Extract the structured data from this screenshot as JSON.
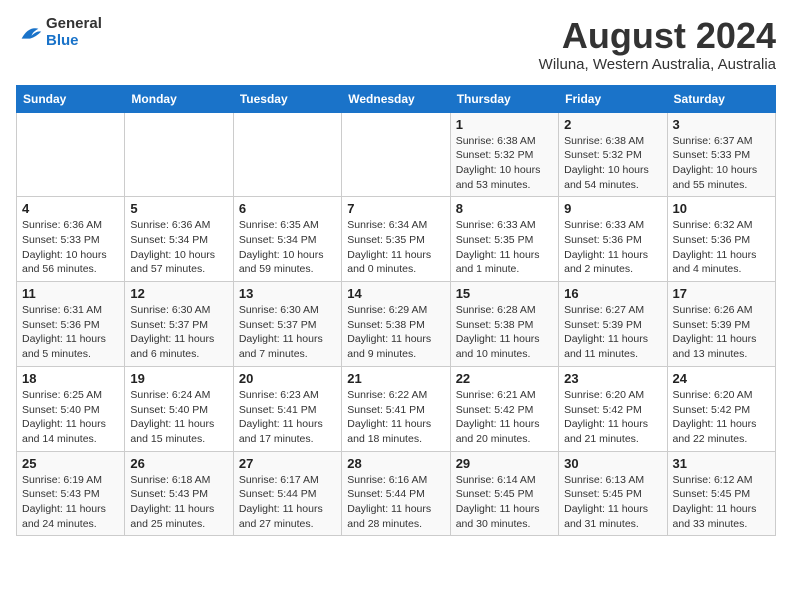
{
  "logo": {
    "text_general": "General",
    "text_blue": "Blue"
  },
  "header": {
    "title": "August 2024",
    "subtitle": "Wiluna, Western Australia, Australia"
  },
  "days_of_week": [
    "Sunday",
    "Monday",
    "Tuesday",
    "Wednesday",
    "Thursday",
    "Friday",
    "Saturday"
  ],
  "weeks": [
    [
      {
        "day": "",
        "info": ""
      },
      {
        "day": "",
        "info": ""
      },
      {
        "day": "",
        "info": ""
      },
      {
        "day": "",
        "info": ""
      },
      {
        "day": "1",
        "info": "Sunrise: 6:38 AM\nSunset: 5:32 PM\nDaylight: 10 hours and 53 minutes."
      },
      {
        "day": "2",
        "info": "Sunrise: 6:38 AM\nSunset: 5:32 PM\nDaylight: 10 hours and 54 minutes."
      },
      {
        "day": "3",
        "info": "Sunrise: 6:37 AM\nSunset: 5:33 PM\nDaylight: 10 hours and 55 minutes."
      }
    ],
    [
      {
        "day": "4",
        "info": "Sunrise: 6:36 AM\nSunset: 5:33 PM\nDaylight: 10 hours and 56 minutes."
      },
      {
        "day": "5",
        "info": "Sunrise: 6:36 AM\nSunset: 5:34 PM\nDaylight: 10 hours and 57 minutes."
      },
      {
        "day": "6",
        "info": "Sunrise: 6:35 AM\nSunset: 5:34 PM\nDaylight: 10 hours and 59 minutes."
      },
      {
        "day": "7",
        "info": "Sunrise: 6:34 AM\nSunset: 5:35 PM\nDaylight: 11 hours and 0 minutes."
      },
      {
        "day": "8",
        "info": "Sunrise: 6:33 AM\nSunset: 5:35 PM\nDaylight: 11 hours and 1 minute."
      },
      {
        "day": "9",
        "info": "Sunrise: 6:33 AM\nSunset: 5:36 PM\nDaylight: 11 hours and 2 minutes."
      },
      {
        "day": "10",
        "info": "Sunrise: 6:32 AM\nSunset: 5:36 PM\nDaylight: 11 hours and 4 minutes."
      }
    ],
    [
      {
        "day": "11",
        "info": "Sunrise: 6:31 AM\nSunset: 5:36 PM\nDaylight: 11 hours and 5 minutes."
      },
      {
        "day": "12",
        "info": "Sunrise: 6:30 AM\nSunset: 5:37 PM\nDaylight: 11 hours and 6 minutes."
      },
      {
        "day": "13",
        "info": "Sunrise: 6:30 AM\nSunset: 5:37 PM\nDaylight: 11 hours and 7 minutes."
      },
      {
        "day": "14",
        "info": "Sunrise: 6:29 AM\nSunset: 5:38 PM\nDaylight: 11 hours and 9 minutes."
      },
      {
        "day": "15",
        "info": "Sunrise: 6:28 AM\nSunset: 5:38 PM\nDaylight: 11 hours and 10 minutes."
      },
      {
        "day": "16",
        "info": "Sunrise: 6:27 AM\nSunset: 5:39 PM\nDaylight: 11 hours and 11 minutes."
      },
      {
        "day": "17",
        "info": "Sunrise: 6:26 AM\nSunset: 5:39 PM\nDaylight: 11 hours and 13 minutes."
      }
    ],
    [
      {
        "day": "18",
        "info": "Sunrise: 6:25 AM\nSunset: 5:40 PM\nDaylight: 11 hours and 14 minutes."
      },
      {
        "day": "19",
        "info": "Sunrise: 6:24 AM\nSunset: 5:40 PM\nDaylight: 11 hours and 15 minutes."
      },
      {
        "day": "20",
        "info": "Sunrise: 6:23 AM\nSunset: 5:41 PM\nDaylight: 11 hours and 17 minutes."
      },
      {
        "day": "21",
        "info": "Sunrise: 6:22 AM\nSunset: 5:41 PM\nDaylight: 11 hours and 18 minutes."
      },
      {
        "day": "22",
        "info": "Sunrise: 6:21 AM\nSunset: 5:42 PM\nDaylight: 11 hours and 20 minutes."
      },
      {
        "day": "23",
        "info": "Sunrise: 6:20 AM\nSunset: 5:42 PM\nDaylight: 11 hours and 21 minutes."
      },
      {
        "day": "24",
        "info": "Sunrise: 6:20 AM\nSunset: 5:42 PM\nDaylight: 11 hours and 22 minutes."
      }
    ],
    [
      {
        "day": "25",
        "info": "Sunrise: 6:19 AM\nSunset: 5:43 PM\nDaylight: 11 hours and 24 minutes."
      },
      {
        "day": "26",
        "info": "Sunrise: 6:18 AM\nSunset: 5:43 PM\nDaylight: 11 hours and 25 minutes."
      },
      {
        "day": "27",
        "info": "Sunrise: 6:17 AM\nSunset: 5:44 PM\nDaylight: 11 hours and 27 minutes."
      },
      {
        "day": "28",
        "info": "Sunrise: 6:16 AM\nSunset: 5:44 PM\nDaylight: 11 hours and 28 minutes."
      },
      {
        "day": "29",
        "info": "Sunrise: 6:14 AM\nSunset: 5:45 PM\nDaylight: 11 hours and 30 minutes."
      },
      {
        "day": "30",
        "info": "Sunrise: 6:13 AM\nSunset: 5:45 PM\nDaylight: 11 hours and 31 minutes."
      },
      {
        "day": "31",
        "info": "Sunrise: 6:12 AM\nSunset: 5:45 PM\nDaylight: 11 hours and 33 minutes."
      }
    ]
  ]
}
